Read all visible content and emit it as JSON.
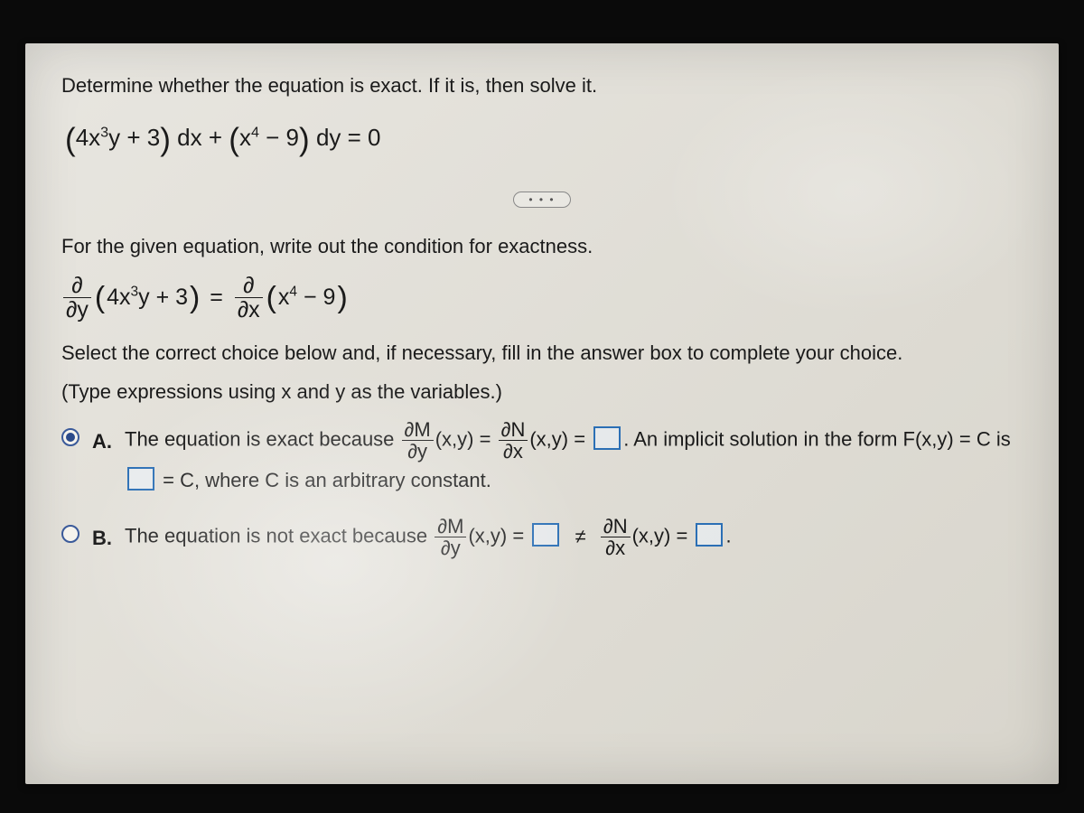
{
  "prompt": "Determine whether the equation is exact. If it is, then solve it.",
  "equation": {
    "M_coeff": "4x",
    "M_exp": "3",
    "M_tail": "y + 3",
    "N_coeff": "x",
    "N_exp": "4",
    "N_tail": " − 9",
    "dx": "dx",
    "plus": "+",
    "dy": "dy",
    "eq0": "= 0"
  },
  "divider_dots": "• • •",
  "condition_intro": "For the given equation, write out the condition for exactness.",
  "condition": {
    "partial": "∂",
    "dy": "∂y",
    "dx": "∂x",
    "left_inner_a": "4x",
    "left_exp": "3",
    "left_inner_b": "y + 3",
    "eq": "=",
    "right_inner_a": "x",
    "right_exp": "4",
    "right_inner_b": " − 9"
  },
  "select_instr": "Select the correct choice below and, if necessary, fill in the answer box to complete your choice.",
  "type_hint": "(Type expressions using x and y as the variables.)",
  "choice_a": {
    "label": "A.",
    "text1": "The equation is exact because ",
    "dM": "∂M",
    "dy": "∂y",
    "xy": "(x,y) = ",
    "dN": "∂N",
    "dx": "∂x",
    "xy2": "(x,y) = ",
    "text2": ". An implicit solution in the form F(x,y) = C is ",
    "text3": " = C, where C is an arbitrary constant."
  },
  "choice_b": {
    "label": "B.",
    "text1": "The equation is not exact because ",
    "dM": "∂M",
    "dy": "∂y",
    "xy": "(x,y) = ",
    "neq": "≠",
    "dN": "∂N",
    "dx": "∂x",
    "xy2": "(x,y) = ",
    "period": "."
  }
}
